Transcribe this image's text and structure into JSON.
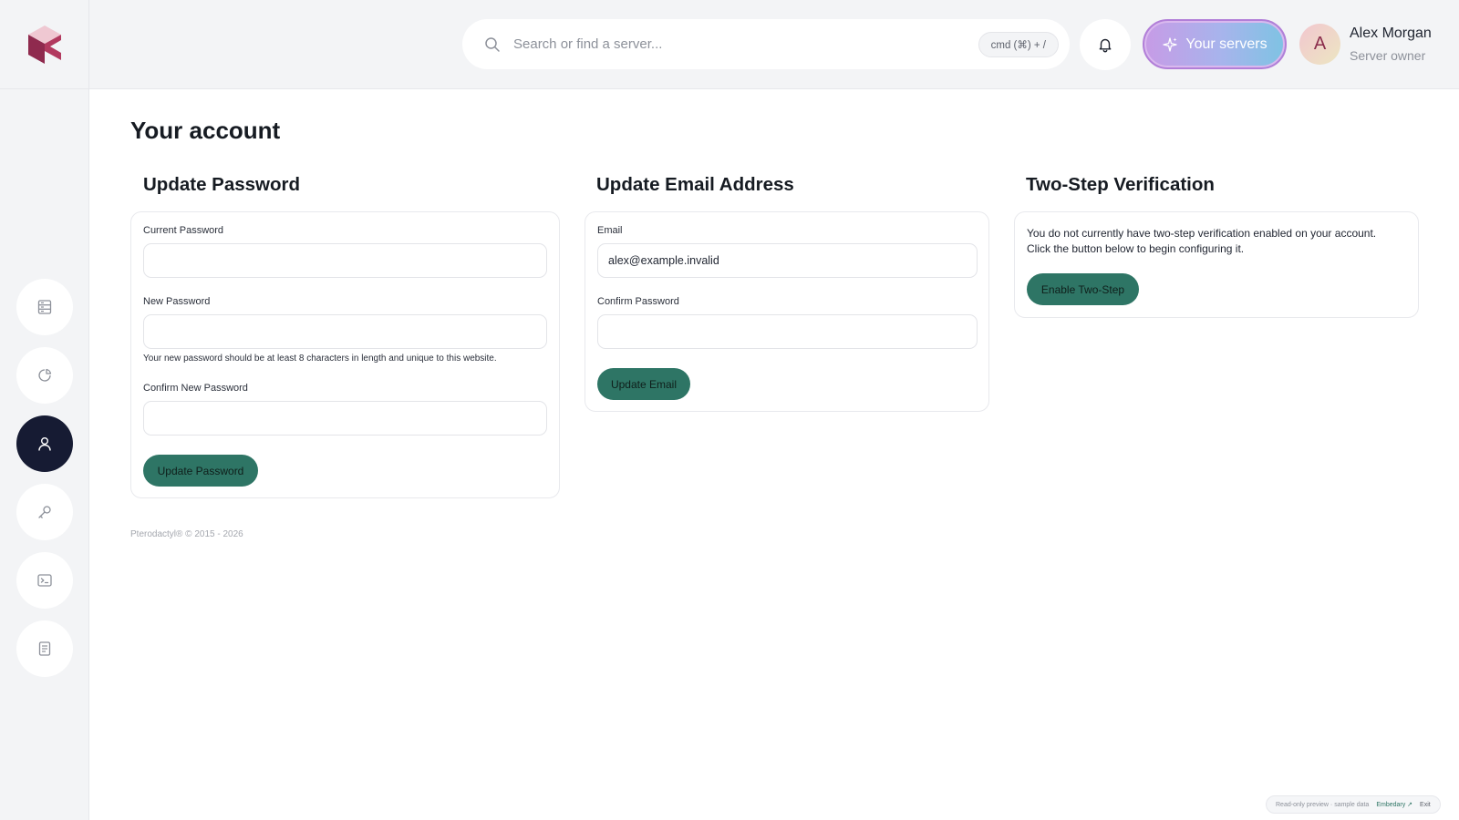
{
  "header": {
    "search_placeholder": "Search or find a server...",
    "search_shortcut": "cmd (⌘) + /",
    "servers_button_label": "Your servers",
    "user": {
      "initial": "A",
      "name": "Alex Morgan",
      "role": "Server owner"
    }
  },
  "sidebar": {
    "items": [
      {
        "id": "servers",
        "icon": "server-list-icon",
        "active": false
      },
      {
        "id": "activity",
        "icon": "pie-chart-icon",
        "active": false
      },
      {
        "id": "account",
        "icon": "user-icon",
        "active": true
      },
      {
        "id": "api-keys",
        "icon": "key-icon",
        "active": false
      },
      {
        "id": "terminal",
        "icon": "terminal-icon",
        "active": false
      },
      {
        "id": "logs",
        "icon": "document-icon",
        "active": false
      }
    ]
  },
  "page": {
    "title": "Your account"
  },
  "password_section": {
    "title": "Update Password",
    "current_label": "Current Password",
    "current_value": "",
    "new_label": "New Password",
    "new_value": "",
    "new_hint": "Your new password should be at least 8 characters in length and unique to this website.",
    "confirm_label": "Confirm New Password",
    "confirm_value": "",
    "button_label": "Update Password"
  },
  "email_section": {
    "title": "Update Email Address",
    "email_label": "Email",
    "email_value": "alex@example.invalid",
    "confirm_label": "Confirm Password",
    "confirm_value": "",
    "button_label": "Update Email"
  },
  "twofa_section": {
    "title": "Two-Step Verification",
    "description_line1": "You do not currently have two-step verification enabled on your account.",
    "description_line2": "Click the button below to begin configuring it.",
    "button_label": "Enable Two-Step"
  },
  "footer": {
    "copyright": "Pterodactyl® © 2015 - 2026"
  },
  "preview_bar": {
    "text": "Read-only preview · sample data",
    "link": "Embedary ↗",
    "exit": "Exit"
  },
  "colors": {
    "accent_button": "#2e7565",
    "active_nav": "#161b33",
    "background": "#f3f4f6"
  }
}
